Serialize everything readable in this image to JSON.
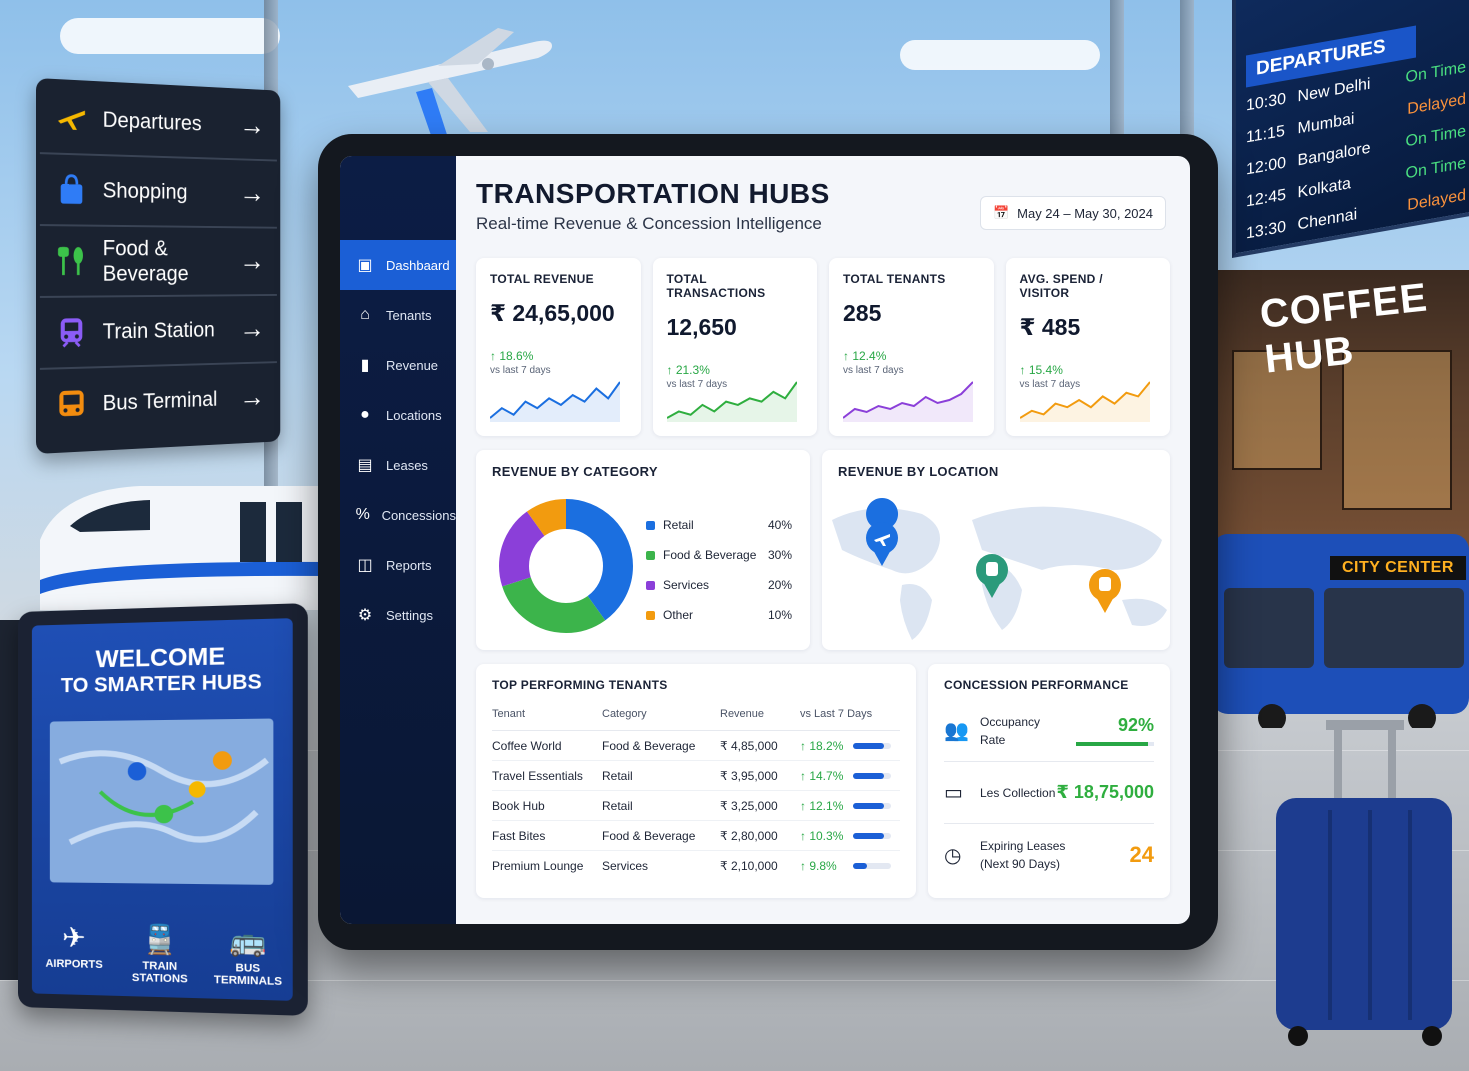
{
  "scene": {
    "wayfinding": [
      {
        "label": "Departures",
        "icon": "plane-icon",
        "color": "#f5b800"
      },
      {
        "label": "Shopping",
        "icon": "shopping-bag-icon",
        "color": "#2f7cf6"
      },
      {
        "label": "Food & Beverage",
        "icon": "cutlery-icon",
        "color": "#3cc24a"
      },
      {
        "label": "Train Station",
        "icon": "train-icon",
        "color": "#8b5cf6"
      },
      {
        "label": "Bus Terminal",
        "icon": "bus-icon",
        "color": "#f28c0f"
      }
    ],
    "departures_board": {
      "title": "DEPARTURES",
      "flights": [
        {
          "time": "10:30",
          "city": "New Delhi",
          "status": "On Time",
          "status_color": "#4ade80"
        },
        {
          "time": "11:15",
          "city": "Mumbai",
          "status": "Delayed",
          "status_color": "#fb923c"
        },
        {
          "time": "12:00",
          "city": "Bangalore",
          "status": "On Time",
          "status_color": "#4ade80"
        },
        {
          "time": "12:45",
          "city": "Kolkata",
          "status": "On Time",
          "status_color": "#4ade80"
        },
        {
          "time": "13:30",
          "city": "Chennai",
          "status": "Delayed",
          "status_color": "#fb923c"
        }
      ]
    },
    "coffee_sign": "COFFEE HUB",
    "bus_sign": "CITY CENTER",
    "kiosk": {
      "title": "WELCOME",
      "subtitle": "TO SMARTER HUBS",
      "items": [
        {
          "label": "AIRPORTS",
          "icon": "plane-icon"
        },
        {
          "label": "TRAIN STATIONS",
          "icon": "train-icon"
        },
        {
          "label": "BUS TERMINALS",
          "icon": "bus-icon"
        }
      ]
    }
  },
  "dashboard": {
    "title": "TRANSPORTATION HUBS",
    "subtitle": "Real-time Revenue & Concession Intelligence",
    "date_range": "May 24 – May 30, 2024",
    "nav": [
      {
        "label": "Dashbaard",
        "icon": "dashboard-icon",
        "active": true
      },
      {
        "label": "Tenants",
        "icon": "store-icon",
        "active": false
      },
      {
        "label": "Revenue",
        "icon": "bar-chart-icon",
        "active": false
      },
      {
        "label": "Locations",
        "icon": "location-pin-icon",
        "active": false
      },
      {
        "label": "Leases",
        "icon": "document-icon",
        "active": false
      },
      {
        "label": "Concessions",
        "icon": "percent-icon",
        "active": false
      },
      {
        "label": "Reports",
        "icon": "report-icon",
        "active": false
      },
      {
        "label": "Settings",
        "icon": "gear-icon",
        "active": false
      }
    ],
    "kpis": [
      {
        "label": "TOTAL REVENUE",
        "value": "₹ 24,65,000",
        "delta": "↑ 18.6%",
        "note": "vs last 7 days",
        "color": "#1b6fe0",
        "spark": [
          3,
          6,
          4,
          8,
          6,
          9,
          7,
          10,
          8,
          12,
          9,
          14
        ]
      },
      {
        "label": "TOTAL TRANSACTIONS",
        "value": "12,650",
        "delta": "↑ 21.3%",
        "note": "vs last 7 days",
        "color": "#2fae3f",
        "spark": [
          3,
          5,
          4,
          7,
          5,
          8,
          7,
          9,
          8,
          11,
          9,
          14
        ]
      },
      {
        "label": "TOTAL TENANTS",
        "value": "285",
        "delta": "↑ 12.4%",
        "note": "vs last 7 days",
        "color": "#8b3fd9",
        "spark": [
          2,
          5,
          4,
          6,
          5,
          7,
          6,
          9,
          7,
          8,
          10,
          14
        ]
      },
      {
        "label": "AVG. SPEND / VISITOR",
        "value": "₹ 485",
        "delta": "↑ 15.4%",
        "note": "vs last 7 days",
        "color": "#f29b0f",
        "spark": [
          3,
          5,
          4,
          7,
          6,
          8,
          6,
          9,
          7,
          10,
          9,
          13
        ]
      }
    ],
    "revenue_by_category": {
      "title": "REVENUE BY CATEGORY",
      "items": [
        {
          "name": "Retail",
          "value": "40%",
          "pct": 40,
          "color": "#1b6fe0"
        },
        {
          "name": "Food & Beverage",
          "value": "30%",
          "pct": 30,
          "color": "#3cb44b"
        },
        {
          "name": "Services",
          "value": "20%",
          "pct": 20,
          "color": "#8b3fd9"
        },
        {
          "name": "Other",
          "value": "10%",
          "pct": 10,
          "color": "#f29b0f"
        }
      ]
    },
    "revenue_by_location": {
      "title": "REVENUE BY LOCATION",
      "pins": [
        {
          "icon": "plane-icon",
          "color": "#1b6fe0"
        },
        {
          "icon": "train-icon",
          "color": "#2b9a7b"
        },
        {
          "icon": "bus-icon",
          "color": "#f29b0f"
        }
      ]
    },
    "tenants": {
      "title": "TOP PERFORMING TENANTS",
      "columns": [
        "Tenant",
        "Category",
        "Revenue",
        "vs Last 7 Days"
      ],
      "rows": [
        {
          "tenant": "Coffee World",
          "category": "Food & Beverage",
          "revenue": "₹ 4,85,000",
          "delta": "↑ 18.2%",
          "bar": 0.8
        },
        {
          "tenant": "Travel Essentials",
          "category": "Retail",
          "revenue": "₹ 3,95,000",
          "delta": "↑ 14.7%",
          "bar": 0.8
        },
        {
          "tenant": "Book Hub",
          "category": "Retail",
          "revenue": "₹ 3,25,000",
          "delta": "↑ 12.1%",
          "bar": 0.8
        },
        {
          "tenant": "Fast Bites",
          "category": "Food & Beverage",
          "revenue": "₹ 2,80,000",
          "delta": "↑ 10.3%",
          "bar": 0.8
        },
        {
          "tenant": "Premium Lounge",
          "category": "Services",
          "revenue": "₹ 2,10,000",
          "delta": "↑ 9.8%",
          "bar": 0.35
        }
      ]
    },
    "concession": {
      "title": "CONCESSION PERFORMANCE",
      "occupancy": {
        "label_1": "Occupancy",
        "label_2": "Rate",
        "value": "92%",
        "pct": 92,
        "color": "#2fae3f",
        "icon": "people-icon"
      },
      "collection": {
        "label": "Les Collection",
        "value": "₹ 18,75,000",
        "color": "#2fae3f",
        "icon": "cash-icon"
      },
      "expiring": {
        "label_1": "Expiring Leases",
        "label_2": "(Next 90 Days)",
        "value": "24",
        "color": "#f29b0f",
        "icon": "clock-icon"
      }
    }
  }
}
